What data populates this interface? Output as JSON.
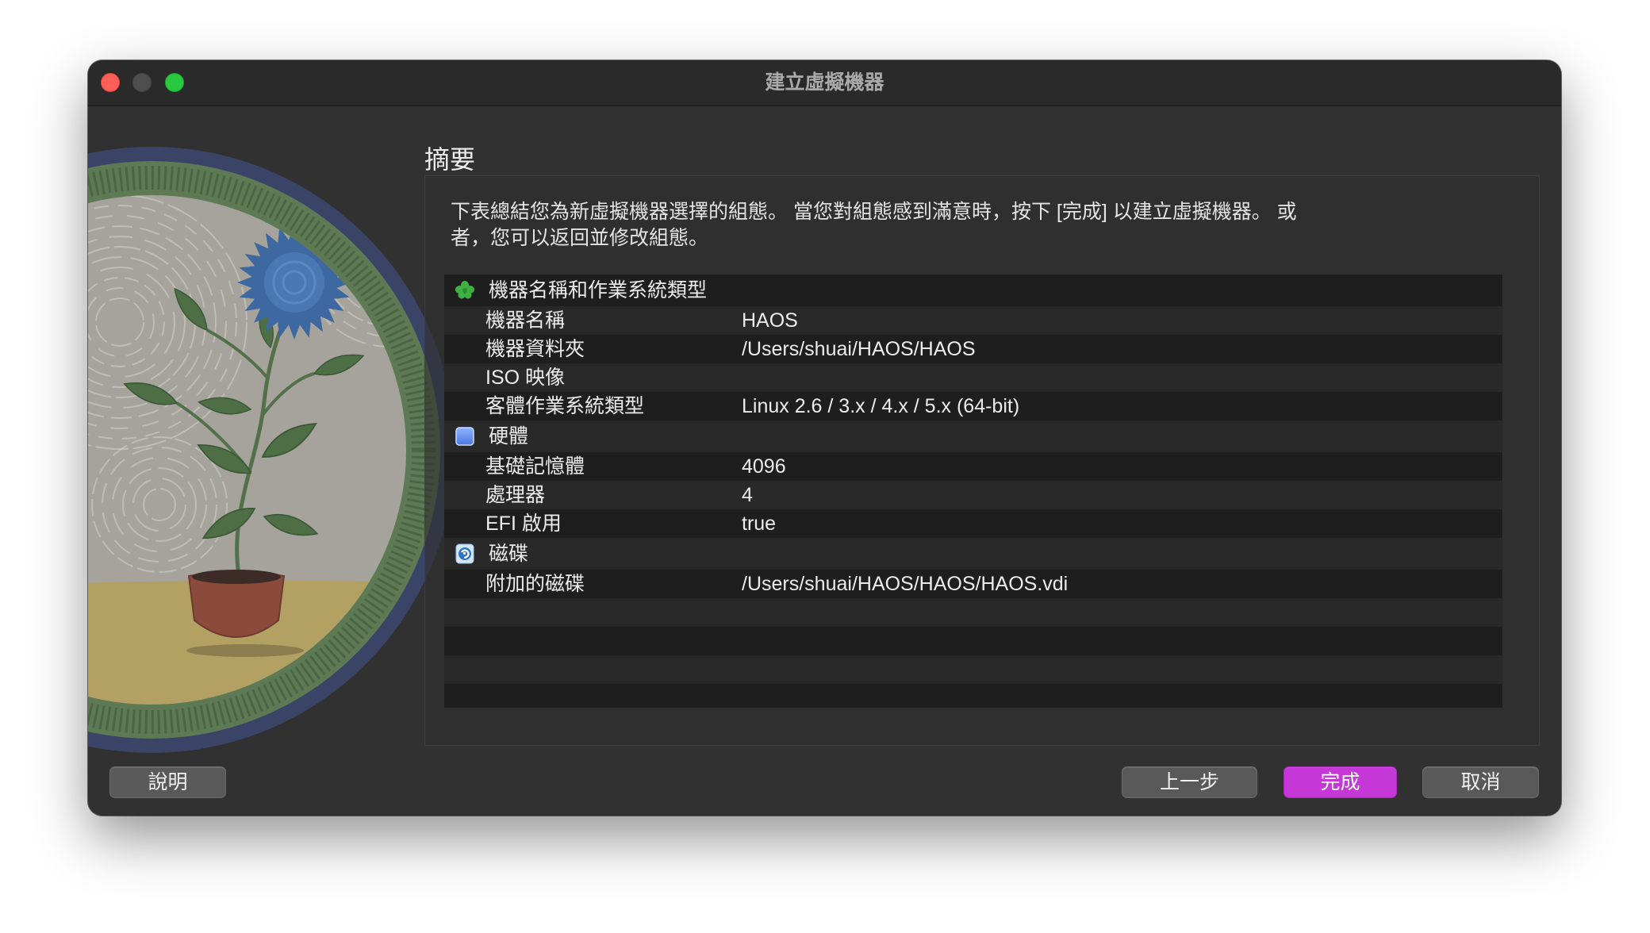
{
  "window": {
    "title": "建立虛擬機器"
  },
  "heading": "摘要",
  "description_lines": [
    "下表總結您為新虛擬機器選擇的組態。 當您對組態感到滿意時，按下 [完成] 以建立虛擬機器。 或",
    "者，您可以返回並修改組態。"
  ],
  "sections": [
    {
      "icon": "clover-icon",
      "title": "機器名稱和作業系統類型",
      "rows": [
        {
          "label": "機器名稱",
          "value": "HAOS"
        },
        {
          "label": "機器資料夾",
          "value": "/Users/shuai/HAOS/HAOS"
        },
        {
          "label": "ISO 映像",
          "value": ""
        },
        {
          "label": "客體作業系統類型",
          "value": "Linux 2.6 / 3.x / 4.x / 5.x (64-bit)"
        }
      ]
    },
    {
      "icon": "hardware-square-icon",
      "title": "硬體",
      "rows": [
        {
          "label": "基礎記憶體",
          "value": "4096"
        },
        {
          "label": "處理器",
          "value": "4"
        },
        {
          "label": "EFI 啟用",
          "value": "true"
        }
      ]
    },
    {
      "icon": "disk-icon",
      "title": "磁碟",
      "rows": [
        {
          "label": "附加的磁碟",
          "value": "/Users/shuai/HAOS/HAOS/HAOS.vdi"
        }
      ]
    }
  ],
  "buttons": {
    "help": "說明",
    "back": "上一步",
    "finish": "完成",
    "cancel": "取消"
  },
  "colors": {
    "accent": "#c537d6",
    "window_bg": "#313131",
    "row_dark": "#1e1e1e",
    "row_light": "#292929"
  }
}
